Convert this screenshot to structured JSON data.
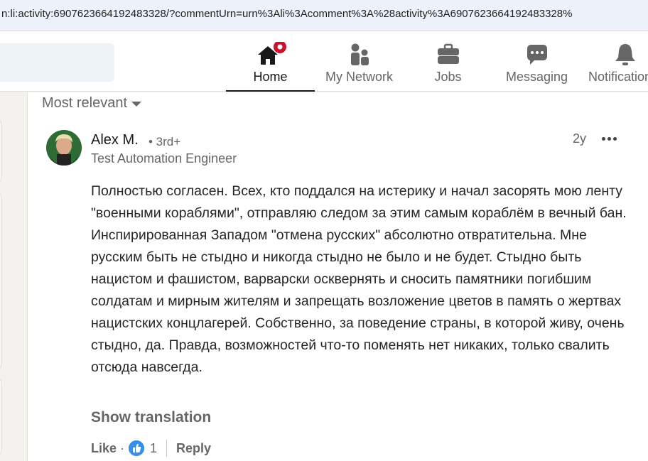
{
  "browser": {
    "url": "n:li:activity:6907623664192483328/?commentUrn=urn%3Ali%3Acomment%3A%28activity%3A6907623664192483328%"
  },
  "nav": {
    "items": [
      {
        "label": "Home",
        "icon": "home-icon",
        "active": true
      },
      {
        "label": "My Network",
        "icon": "network-icon"
      },
      {
        "label": "Jobs",
        "icon": "briefcase-icon"
      },
      {
        "label": "Messaging",
        "icon": "messaging-icon"
      },
      {
        "label": "Notifications",
        "icon": "bell-icon"
      }
    ],
    "home_badge_color": "#cb112d"
  },
  "comments": {
    "sort_label": "Most relevant",
    "comment": {
      "author": "Alex M.",
      "degree": "• 3rd+",
      "headline": "Test Automation Engineer",
      "time": "2y",
      "text": "Полностью согласен. Всех, кто поддался на истерику и начал засорять мою ленту \"военными кораблями\", отправляю следом за этим самым кораблём в вечный бан. Инспирированная Западом \"отмена русских\" абсолютно отвратительна. Мне русским быть не стыдно и никогда стыдно не было и не будет. Стыдно быть нацистом и фашистом, варварски осквернять и сносить памятники погибшим солдатам и мирным жителям и запрещать возложение цветов в память о жертвах нацистских концлагерей. Собственно, за поведение страны, в которой живу, очень стыдно, да. Правда, возможностей что-то поменять нет никаких, только свалить отсюда навсегда.",
      "show_translation": "Show translation",
      "like_label": "Like",
      "like_separator": "·",
      "reaction_count": "1",
      "reply_label": "Reply"
    }
  },
  "colors": {
    "reaction_blue": "#378fe9",
    "active_underline": "#191919"
  }
}
